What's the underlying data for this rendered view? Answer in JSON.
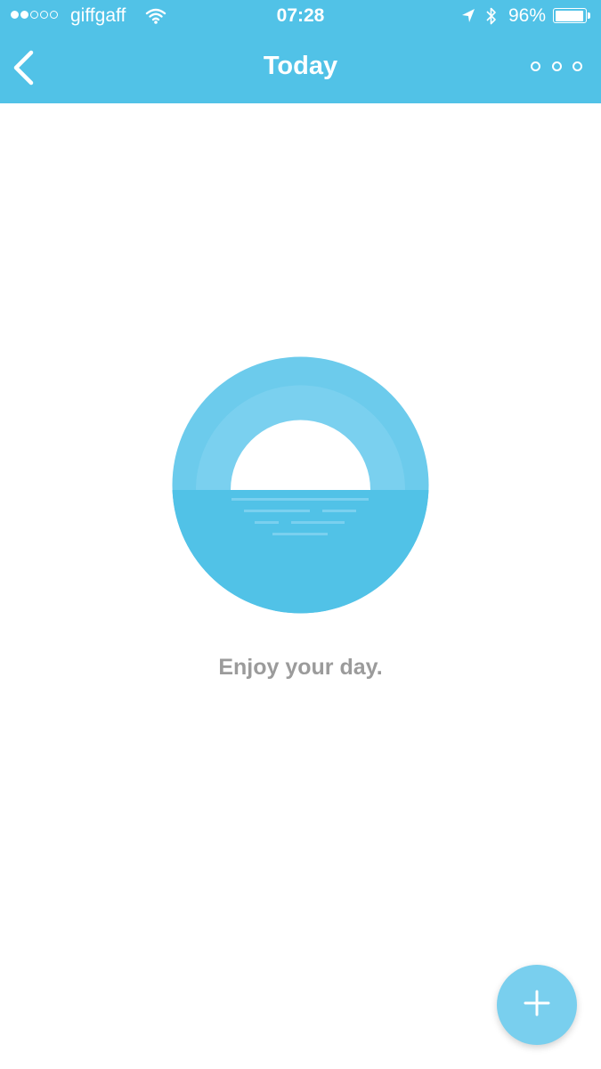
{
  "status_bar": {
    "carrier": "giffgaff",
    "time": "07:28",
    "battery_percent": "96%",
    "battery_level": 0.96,
    "signal_strength_dots": 2,
    "icons": [
      "wifi-icon",
      "location-arrow-icon",
      "bluetooth-icon",
      "battery-icon"
    ]
  },
  "header": {
    "title": "Today",
    "back_icon": "chevron-left-icon",
    "more_icon": "more-options-icon"
  },
  "empty_state": {
    "illustration": "sunset-over-sea-illustration",
    "message": "Enjoy your day."
  },
  "fab": {
    "icon": "plus-icon"
  },
  "colors": {
    "header_bg": "#51c2e7",
    "accent": "#51c2e7",
    "sun_ring": "#7ad0ef",
    "fab_bg": "#79cfee",
    "message_text": "#9b9b9b",
    "background": "#ffffff"
  }
}
